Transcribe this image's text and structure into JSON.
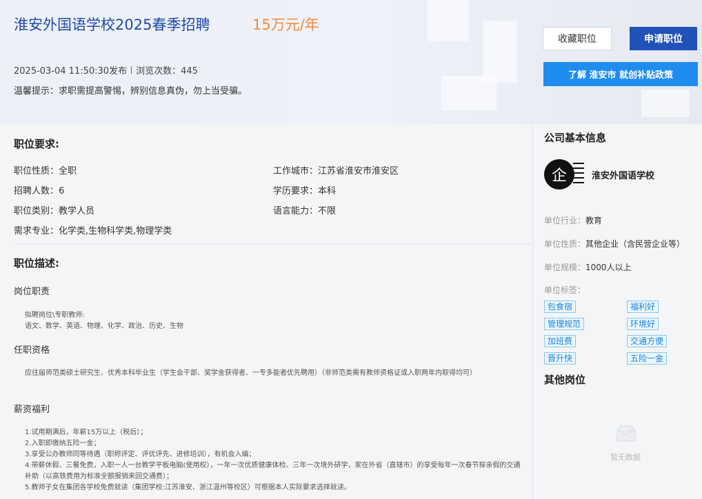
{
  "job": {
    "title": "淮安外国语学校2025春季招聘",
    "salary": "15万元/年",
    "published": "2025-03-04 11:50:30发布",
    "views": "浏览次数：445",
    "tip": "温馨提示：求职需提高警惕，辨别信息真伪，勿上当受骗。"
  },
  "actions": {
    "favorite": "收藏职位",
    "apply": "申请职位",
    "policy_prefix": "了解 ",
    "policy_city": "淮安市",
    "policy_suffix": " 就创补贴政策"
  },
  "requirements": {
    "title": "职位要求:",
    "nature_label": "职位性质：",
    "nature": "全职",
    "city_label": "工作城市：",
    "city": "江苏省淮安市淮安区",
    "count_label": "招聘人数：",
    "count": "6",
    "edu_label": "学历要求：",
    "edu": "本科",
    "category_label": "职位类别：",
    "category": "教学人员",
    "lang_label": "语言能力：",
    "lang": "不限",
    "major_label": "需求专业：",
    "major": "化学类,生物科学类,物理学类"
  },
  "description": {
    "title": "职位描述:",
    "duty_title": "岗位职责",
    "duty_line1": "拟聘岗位\\专职教师:",
    "duty_line2": "语文、数学、英语、物理、化学、政治、历史、生物",
    "qual_title": "任职资格",
    "qual_text": "应往届师范类硕士研究生、优秀本科毕业生（学生会干部、奖学金获得者、一专多能者优先聘用）（非师范类需有教师资格证或入职两年内取得均可）",
    "benefit_title": "薪资福利",
    "benefits": [
      "1.试用期满后，年薪15万以上（税后）；",
      "2.入职即缴纳五险一金；",
      "3.享受公办教师同等待遇（职称评定、评优评先、进修培训），有机会入编；",
      "4.带薪休假、三餐免费，入职一人一台教学平板电脑(使用权），一年一次优质健康体检、三年一次境外研学，家在外省（直辖市）的享受每年一次春节探亲假的交通补助（以高铁费用为标准全额报销来回交通费）；",
      "5.教师子女在集团各学校免费就读（集团学校:江苏淮安、浙江温州等校区）可根据本人实际要求选择就读。"
    ]
  },
  "company": {
    "section_title": "公司基本信息",
    "logo_char": "企",
    "name": "淮安外国语学校",
    "industry_label": "单位行业：",
    "industry": "教育",
    "nature_label": "单位性质：",
    "nature": "其他企业（含民营企业等）",
    "size_label": "单位规模：",
    "size": "1000人以上",
    "tags_label": "单位标签：",
    "tags": [
      "包食宿",
      "福利好",
      "管理规范",
      "环境好",
      "加班费",
      "交通方便",
      "晋升快",
      "五险一金"
    ]
  },
  "other_jobs": {
    "title": "其他岗位",
    "empty": "暂无数据"
  }
}
